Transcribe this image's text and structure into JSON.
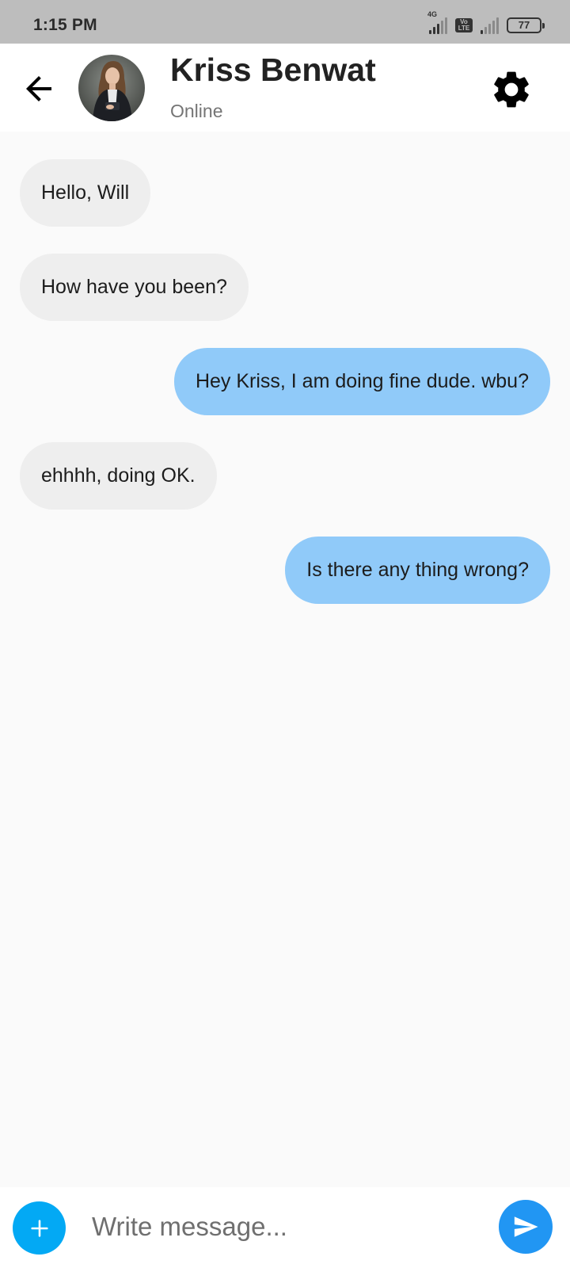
{
  "status_bar": {
    "time": "1:15 PM",
    "network_label": "4G",
    "volte_label": "Vo LTE",
    "battery": "77"
  },
  "header": {
    "contact_name": "Kriss Benwat",
    "contact_status": "Online",
    "back_icon": "arrow-back-icon",
    "settings_icon": "gear-icon"
  },
  "messages": [
    {
      "text": "Hello, Will",
      "direction": "incoming"
    },
    {
      "text": "How have you been?",
      "direction": "incoming"
    },
    {
      "text": "Hey Kriss, I am doing fine dude. wbu?",
      "direction": "outgoing"
    },
    {
      "text": "ehhhh, doing OK.",
      "direction": "incoming"
    },
    {
      "text": "Is there any thing wrong?",
      "direction": "outgoing"
    }
  ],
  "composer": {
    "placeholder": "Write message...",
    "value": "",
    "add_icon": "plus-icon",
    "send_icon": "send-icon"
  },
  "colors": {
    "incoming_bubble": "#eeeeee",
    "outgoing_bubble": "#90caf9",
    "add_button": "#03a9f4",
    "send_button": "#2196f3",
    "status_bar": "#bdbdbd"
  }
}
